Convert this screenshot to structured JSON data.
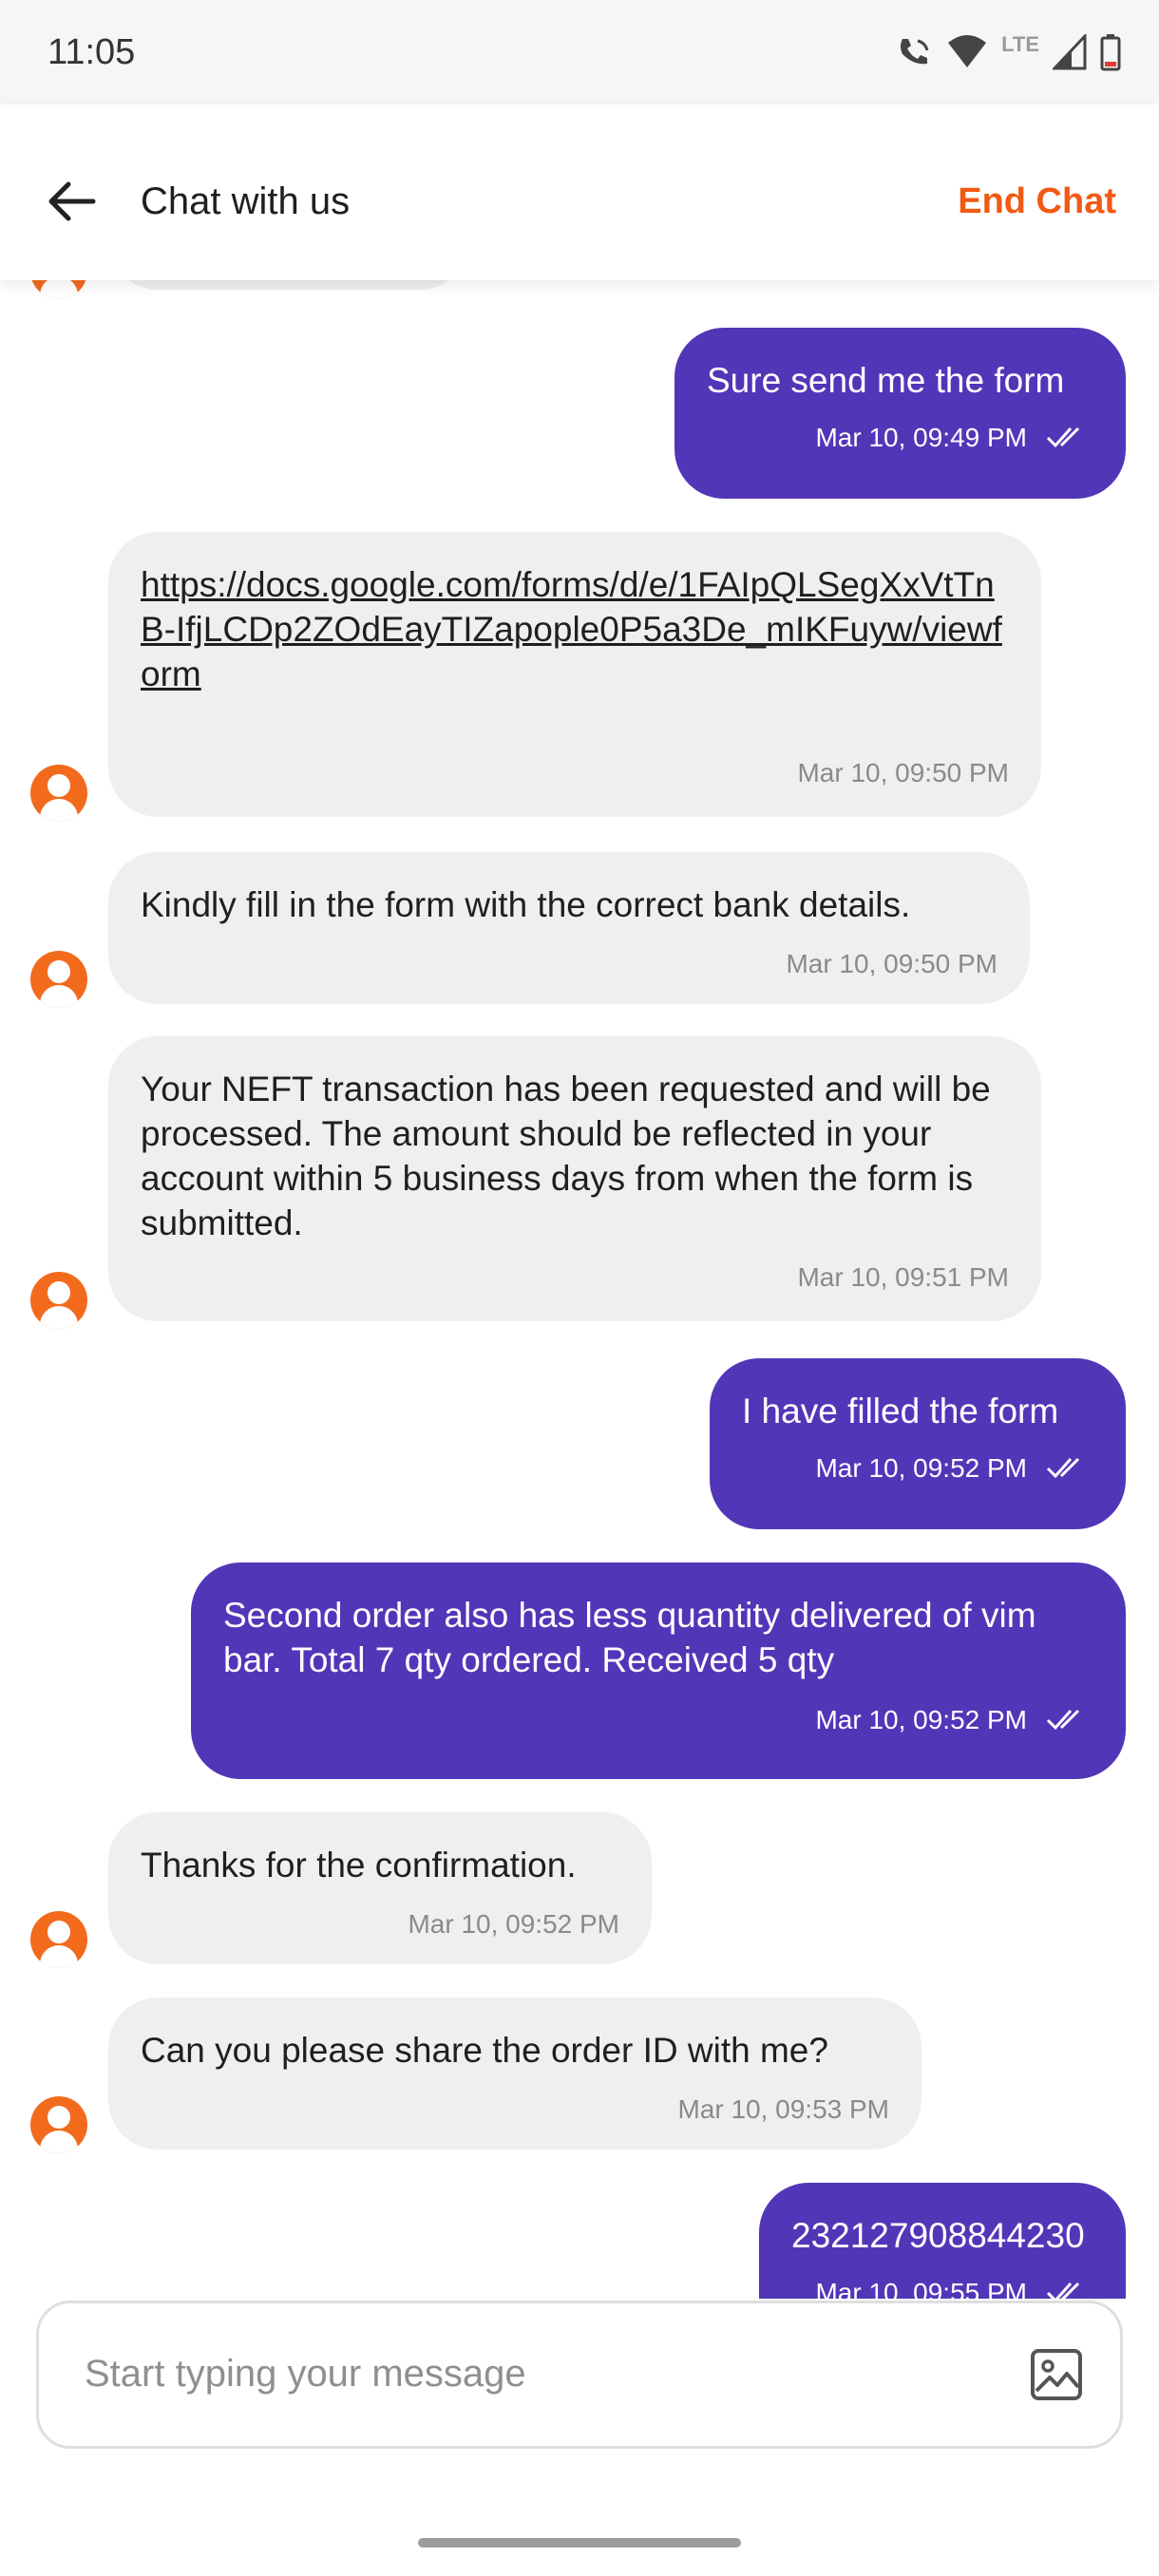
{
  "status_bar": {
    "time": "11:05",
    "network": "LTE"
  },
  "header": {
    "title": "Chat with us",
    "end_chat_label": "End Chat"
  },
  "messages": [
    {
      "sender": "user",
      "text": "Sure send me the form",
      "time": "Mar 10, 09:49 PM"
    },
    {
      "sender": "agent",
      "text": "https://docs.google.com/forms/d/e/1FAIpQLSegXxVtTnB-IfjLCDp2ZOdEayTIZapople0P5a3De_mIKFuyw/viewform",
      "time": "Mar 10, 09:50 PM"
    },
    {
      "sender": "agent",
      "text": "Kindly fill in the form with the correct bank details.",
      "time": "Mar 10, 09:50 PM"
    },
    {
      "sender": "agent",
      "text": "Your NEFT transaction has been requested and will be processed. The amount should be reflected in your account within 5 business days from when the form is submitted.",
      "time": "Mar 10, 09:51 PM"
    },
    {
      "sender": "user",
      "text": "I have filled the form",
      "time": "Mar 10, 09:52 PM"
    },
    {
      "sender": "user",
      "text": "Second order also has less quantity delivered of vim bar. Total 7 qty ordered. Received 5 qty",
      "time": "Mar 10, 09:52 PM"
    },
    {
      "sender": "agent",
      "text": "Thanks for the confirmation.",
      "time": "Mar 10, 09:52 PM"
    },
    {
      "sender": "agent",
      "text": "Can you please share the order ID with me?",
      "time": "Mar 10, 09:53 PM"
    },
    {
      "sender": "user",
      "text": "232127908844230",
      "time": "Mar 10, 09:55 PM"
    }
  ],
  "composer": {
    "placeholder": "Start typing your message"
  },
  "colors": {
    "accent": "#f05a14",
    "user_bubble": "#5236b8",
    "agent_bubble": "#efeff1",
    "avatar": "#f26b1d"
  },
  "icons": [
    "back-arrow-icon",
    "image-attach-icon",
    "read-ticks-icon",
    "agent-avatar-icon"
  ]
}
